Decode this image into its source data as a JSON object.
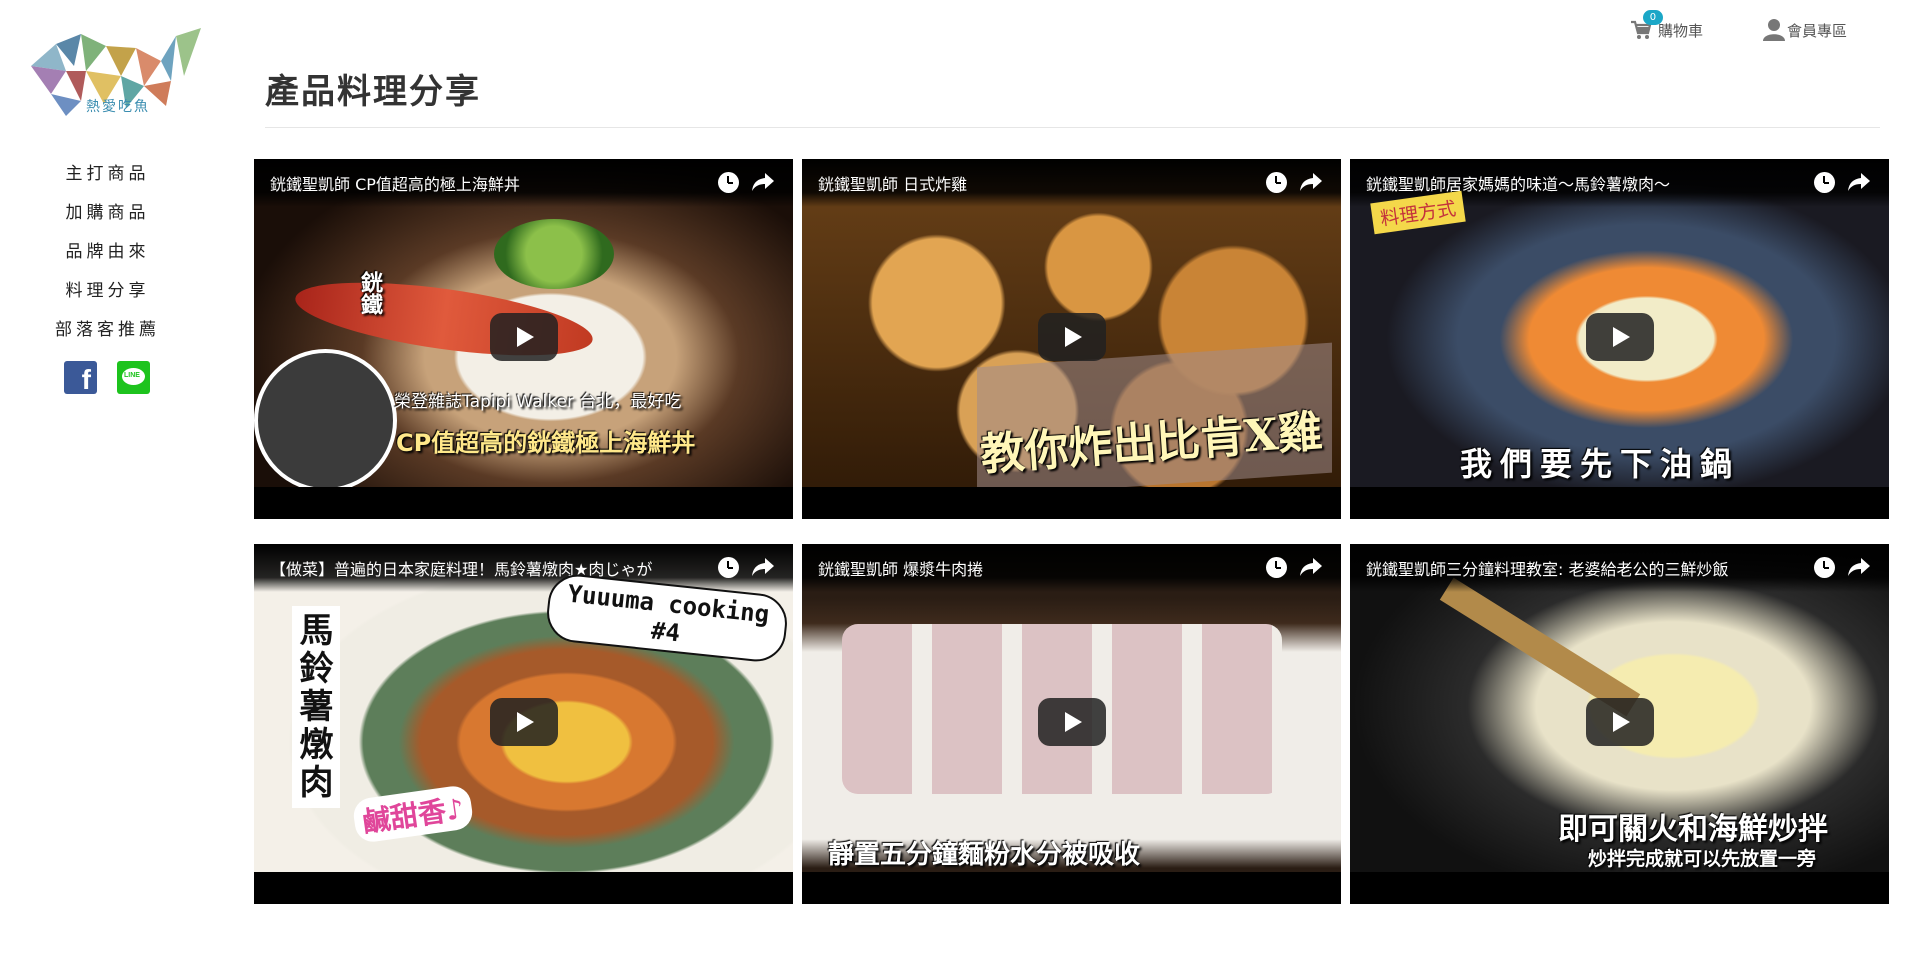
{
  "sidebar": {
    "logo_text": "熱愛吃魚",
    "nav": [
      "主打商品",
      "加購商品",
      "品牌由來",
      "料理分享",
      "部落客推薦"
    ],
    "social": [
      {
        "name": "facebook",
        "icon": "facebook-icon",
        "glyph": "f",
        "color": "#3b5998"
      },
      {
        "name": "line",
        "icon": "line-icon",
        "glyph": "LINE",
        "color": "#1dc31d"
      }
    ]
  },
  "header": {
    "cart_label": "購物車",
    "cart_count": "0",
    "member_label": "會員專區",
    "accent": "#1ba7c7"
  },
  "page": {
    "title": "產品料理分享"
  },
  "videos": [
    {
      "title": "銧鐵聖凱師 CP值超高的極上海鮮丼",
      "caption_line1": "榮登雜誌Tapipi Walker 台北，最好吃",
      "caption_line2": "CP值超高的銧鐵極上海鮮丼",
      "logo_text": "銧鐵"
    },
    {
      "title": "銧鐵聖凱師 日式炸雞",
      "caption": "教你炸出比肯X雞"
    },
    {
      "title": "銧鐵聖凱師居家媽媽的味道～馬鈴薯燉肉～",
      "tag": "料理方式",
      "caption": "我們要先下油鍋"
    },
    {
      "title": "【做菜】普遍的日本家庭料理！馬鈴薯燉肉★肉じゃが",
      "caption_side": "馬鈴薯燉肉",
      "caption_corner": "Yuuuma cooking #4",
      "caption_bottom": "鹹甜香♪"
    },
    {
      "title": "銧鐵聖凱師 爆漿牛肉捲",
      "caption": "靜置五分鐘麵粉水分被吸收"
    },
    {
      "title": "銧鐵聖凱師三分鐘料理教室: 老婆給老公的三鮮炒飯",
      "caption_line1": "即可關火和海鮮炒拌",
      "caption_line2": "炒拌完成就可以先放置一旁"
    }
  ]
}
